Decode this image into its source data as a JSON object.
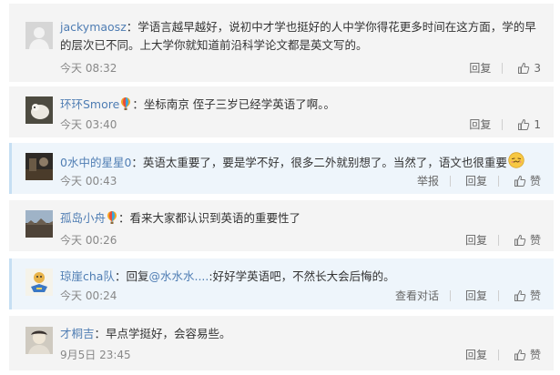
{
  "comments": [
    {
      "username": "jackymaosz",
      "text": "：学语言越早越好，说初中才学也挺好的人中学你得花更多时间在这方面，学的早的层次已不同。上大学你就知道前沿科学论文都是英文写的。",
      "time": "今天 08:32",
      "reply_label": "回复",
      "like_count": "3"
    },
    {
      "username": "环环Smore",
      "text": "：坐标南京 侄子三岁已经学英语了啊。。",
      "time": "今天 03:40",
      "reply_label": "回复",
      "like_count": "1"
    },
    {
      "username": "0水中的星星0",
      "text": "：英语太重要了，要是学不好，很多二外就别想了。当然了，语文也很重要",
      "time": "今天 00:43",
      "report_label": "举报",
      "reply_label": "回复",
      "like_label": "赞"
    },
    {
      "username": "孤岛小舟",
      "text": "：看来大家都认识到英语的重要性了",
      "time": "今天 00:26",
      "reply_label": "回复",
      "like_label": "赞"
    },
    {
      "username": "琼崖cha队",
      "text_prefix": "：回复",
      "mention": "@水水水....",
      "text": ":好好学英语吧，不然长大会后悔的。",
      "time": "今天 00:24",
      "view_conversation_label": "查看对话",
      "reply_label": "回复",
      "like_label": "赞"
    },
    {
      "username": "才桐吉",
      "text": "：早点学挺好，会容易些。",
      "time": "9月5日 23:45",
      "reply_label": "回复",
      "like_label": "赞"
    }
  ],
  "colors": {
    "username": "#4f7db3",
    "card_bg": "#f4f4f4",
    "highlight_bg": "#eef5fb",
    "meta_text": "#888888"
  }
}
